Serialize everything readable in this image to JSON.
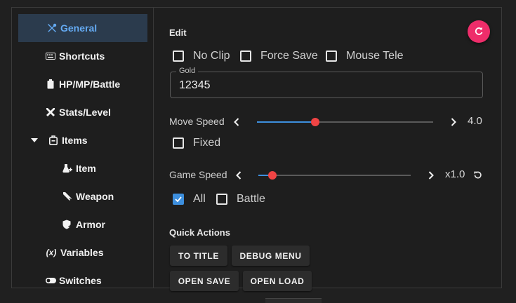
{
  "sidebar": {
    "items": [
      {
        "label": "General",
        "icon": "tools-icon"
      },
      {
        "label": "Shortcuts",
        "icon": "keyboard-icon"
      },
      {
        "label": "HP/MP/Battle",
        "icon": "battery-icon"
      },
      {
        "label": "Stats/Level",
        "icon": "crossed-swords-icon"
      },
      {
        "label": "Items",
        "icon": "bag-icon"
      },
      {
        "label": "Item",
        "icon": "potion-icon"
      },
      {
        "label": "Weapon",
        "icon": "sword-icon"
      },
      {
        "label": "Armor",
        "icon": "shield-plus-icon"
      },
      {
        "label": "Variables",
        "icon": "variable-icon"
      },
      {
        "label": "Switches",
        "icon": "toggle-icon"
      }
    ]
  },
  "edit": {
    "heading": "Edit",
    "no_clip": "No Clip",
    "force_save": "Force Save",
    "mouse_tele": "Mouse Tele",
    "gold_label": "Gold",
    "gold_value": "12345"
  },
  "move_speed": {
    "label": "Move Speed",
    "value_text": "4.0",
    "level": 0.33,
    "fixed_label": "Fixed"
  },
  "game_speed": {
    "label": "Game Speed",
    "value_text": "x1.0",
    "level": 0.09,
    "all_label": "All",
    "battle_label": "Battle"
  },
  "quick_actions": {
    "heading": "Quick Actions",
    "to_title": "TO TITLE",
    "debug_menu": "DEBUG MENU",
    "open_save": "OPEN SAVE",
    "open_load": "OPEN LOAD"
  },
  "colors": {
    "accent": "#3d8fde",
    "fab": "#ee2d6a",
    "slider_thumb": "#f04444",
    "active_bg": "#2b3b4d"
  }
}
